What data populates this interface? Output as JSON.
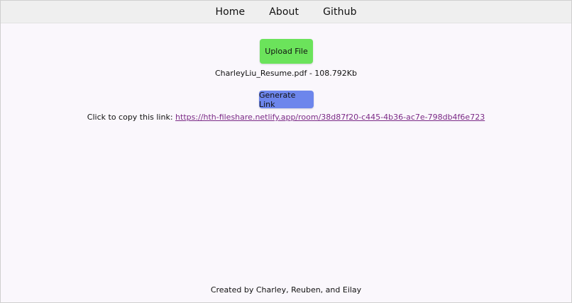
{
  "nav": {
    "items": [
      "Home",
      "About",
      "Github"
    ]
  },
  "upload": {
    "label": "Upload File",
    "file_name": "CharleyLiu_Resume.pdf",
    "file_size": "108.792Kb",
    "file_info": "CharleyLiu_Resume.pdf - 108.792Kb"
  },
  "generate": {
    "label": "Generate Link"
  },
  "share": {
    "prompt": "Click to copy this link:",
    "url": "https://hth-fileshare.netlify.app/room/38d87f20-c445-4b36-ac7e-798db4f6e723"
  },
  "footer": {
    "text": "Created by Charley, Reuben, and Eilay"
  },
  "colors": {
    "upload_button": "#6be35b",
    "generate_button": "#6d86ec",
    "link": "#7b2a86",
    "navbar": "#efefef",
    "background": "#faf7fc"
  }
}
